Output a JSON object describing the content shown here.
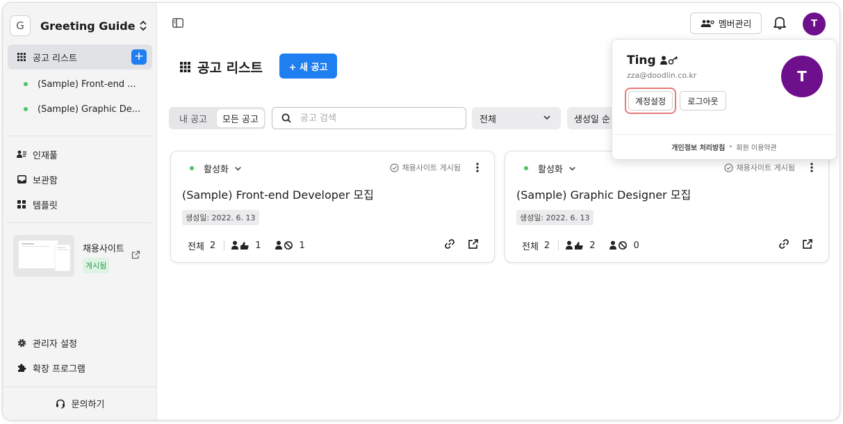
{
  "sidebar": {
    "workspace_initial": "G",
    "workspace_name": "Greeting Guide",
    "nav_active_label": "공고 리스트",
    "add_button_label": "+",
    "postings": [
      {
        "label": "(Sample) Front-end ..."
      },
      {
        "label": "(Sample) Graphic De..."
      }
    ],
    "talent_pool_label": "인재풀",
    "archive_label": "보관함",
    "template_label": "템플릿",
    "career_site_label": "채용사이트",
    "career_site_status": "게시됨",
    "admin_settings_label": "관리자 설정",
    "extensions_label": "확장 프로그램",
    "inquiry_label": "문의하기"
  },
  "header": {
    "member_management_label": "멤버관리",
    "avatar_initial": "T",
    "avatar_color": "#6e0f8c"
  },
  "main": {
    "page_title": "공고 리스트",
    "new_posting_label": "+ 새 공고",
    "filter_mine_label": "내 공고",
    "filter_all_label": "모든 공고",
    "search_placeholder": "공고 검색",
    "status_select_value": "전체",
    "sort_select_value": "생성일 순",
    "cards": [
      {
        "status": "활성화",
        "published_label": "채용사이트 게시됨",
        "title": "(Sample) Front-end Developer 모집",
        "created": "생성일: 2022. 6. 13",
        "total_label": "전체",
        "total": "2",
        "passed": "1",
        "rejected": "1"
      },
      {
        "status": "활성화",
        "published_label": "채용사이트 게시됨",
        "title": "(Sample) Graphic Designer 모집",
        "created": "생성일: 2022. 6. 13",
        "total_label": "전체",
        "total": "2",
        "passed": "2",
        "rejected": "0"
      }
    ]
  },
  "account_popover": {
    "name": "Ting",
    "email": "zza@doodlin.co.kr",
    "avatar_initial": "T",
    "account_settings_label": "계정설정",
    "logout_label": "로그아웃",
    "privacy_policy_label": "개인정보 처리방침",
    "separator": "•",
    "terms_label": "회원 이용약관"
  },
  "colors": {
    "accent": "#1f7ef0",
    "active_dot": "#4cc46a",
    "highlight_border": "#e77979"
  }
}
